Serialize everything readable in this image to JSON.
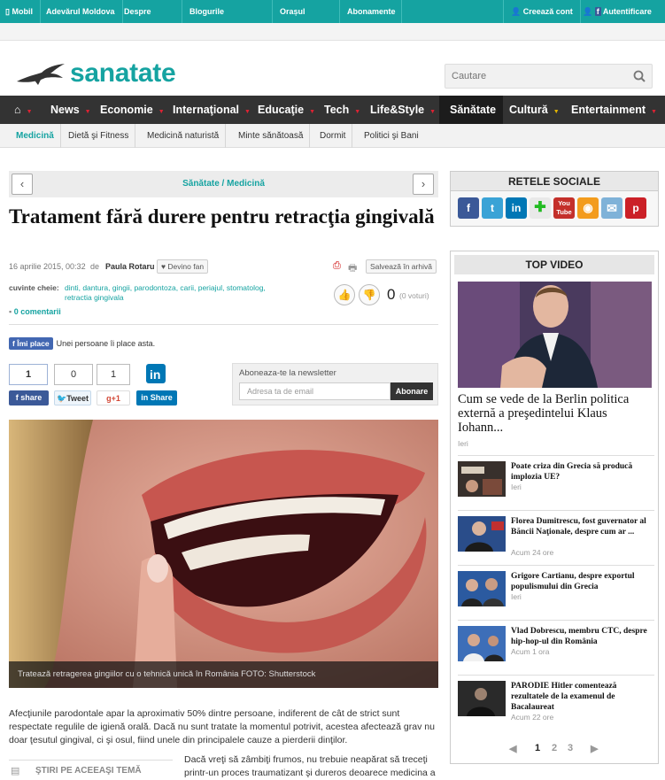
{
  "topbar": {
    "mobil": "Mobil",
    "site": "Adevărul Moldova",
    "despre": "Despre noi",
    "bloguri": "Blogurile Adevărul",
    "oras": "Orașul meu",
    "abonamente": "Abonamente",
    "creeaza": "Creează cont",
    "autentificare": "Autentificare"
  },
  "header": {
    "logo_text": "sanatate",
    "search_placeholder": "Cautare"
  },
  "mainnav": [
    "News",
    "Economie",
    "Internaţional",
    "Educaţie",
    "Tech",
    "Life&Style",
    "Sănătate",
    "Cultură",
    "Entertainment"
  ],
  "subnav": [
    "Medicină",
    "Dietă şi Fitness",
    "Medicină naturistă",
    "Minte sănătoasă",
    "Dormit",
    "Politici şi Bani"
  ],
  "article": {
    "breadcrumb": "Sănătate / Medicină",
    "title": "Tratament fără durere pentru retracţia gingivală",
    "date": "16 aprilie 2015, 00:32",
    "by": "de",
    "author": "Paula Rotaru",
    "follow_label": "Devino fan",
    "save_label": "Salvează în arhivă",
    "tags_label": "cuvinte cheie:",
    "tags": "dinti, dantura, gingii, parodontoza, carii, periajul, stomatolog, retractia gingivala",
    "vote_count": "0",
    "votes_label": "(0 voturi)",
    "comments": "0 comentarii",
    "fb_like": "Îmi place",
    "fb_like_text": "Unei persoane îi place asta.",
    "caption": "Tratează retragerea gingiilor cu o tehnică unică în România FOTO: Shutterstock",
    "paragraph1": "Afecţiunile parodontale apar la aproximativ 50% dintre persoane, indiferent de cât de strict sunt respectate regulile de igienă orală. Dacă nu sunt tratate la momentul potrivit, acestea afectează grav nu doar ţesutul gingival, ci şi osul, fiind unele din principalele cauze a pierderii dinţilor.",
    "paragraph2": "Dacă vreţi să zâmbiţi frumos, nu trebuie neapărat să treceţi printr-un proces traumatizant şi dureros deoarece medicina a",
    "related_label": "ŞTIRI PE ACEEAŞI TEMĂ"
  },
  "share": {
    "fb_count": "1",
    "tw_count": "0",
    "gp_count": "1",
    "fb_label": "share",
    "tw_label": "Tweet",
    "gp_label": "+1",
    "in_label": "Share"
  },
  "newsletter": {
    "label": "Aboneaza-te la newsletter",
    "placeholder": "Adresa ta de email",
    "button": "Abonare"
  },
  "sidebar": {
    "social_title": "RETELE SOCIALE",
    "top_video_title": "TOP VIDEO",
    "featured_title": "Cum se vede de la Berlin politica externă a preşedintelui Klaus Iohann...",
    "featured_date": "Ieri",
    "videos": [
      {
        "title": "Poate criza din Grecia să producă implozia UE?",
        "date": "Ieri"
      },
      {
        "title": "Florea Dumitrescu, fost guvernator al Băncii Naţionale, despre cum ar ...",
        "date": "Acum 24 ore"
      },
      {
        "title": "Grigore Cartianu, despre exportul populismului din Grecia",
        "date": "Ieri"
      },
      {
        "title": "Vlad Dobrescu, membru CTC, despre hip-hop-ul din România",
        "date": "Acum 1 ora"
      },
      {
        "title": "PARODIE Hitler comentează rezultatele de la examenul de Bacalaureat",
        "date": "Acum 22 ore"
      }
    ],
    "pages": [
      "1",
      "2",
      "3"
    ]
  },
  "colors": {
    "brand": "#15a3a1",
    "nav_bg": "#333333",
    "accent_red": "#dd2233"
  }
}
